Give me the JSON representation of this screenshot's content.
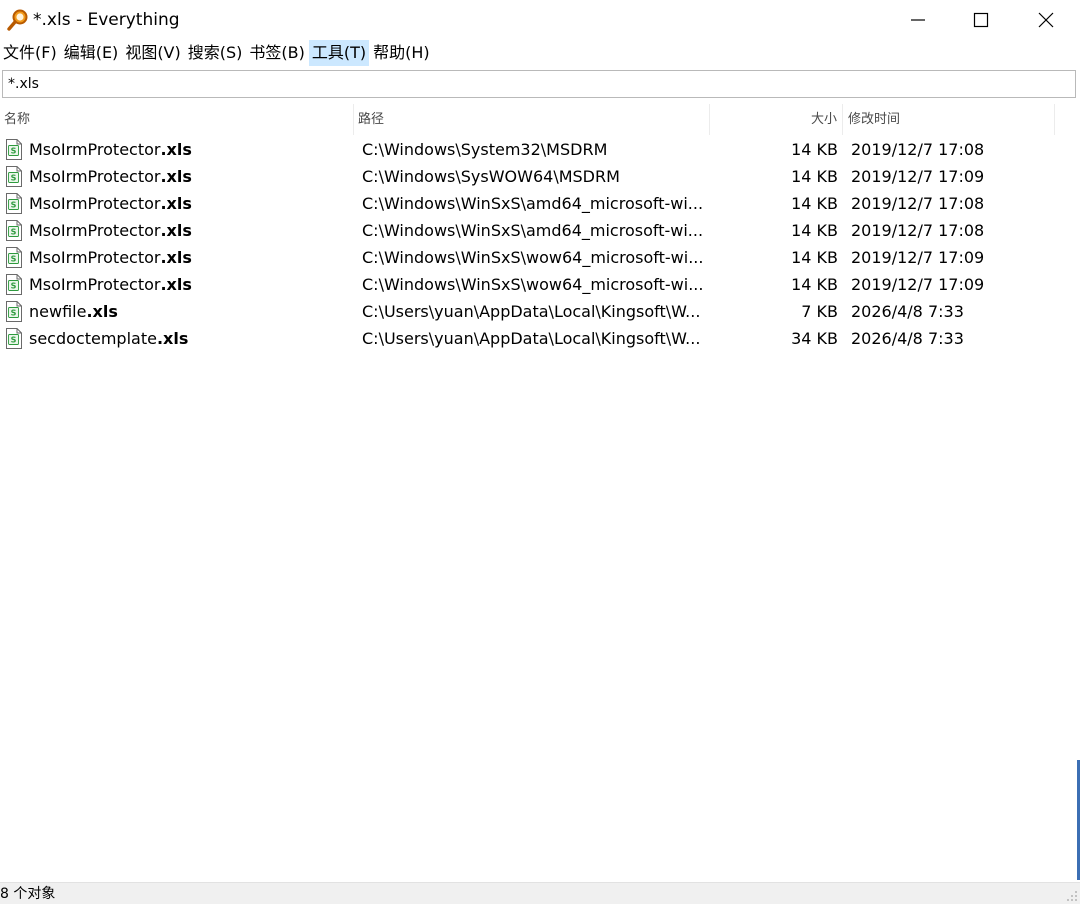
{
  "window": {
    "title": "*.xls - Everything",
    "accent_color": "#e8700f"
  },
  "menu": {
    "items": [
      {
        "label": "文件(F)",
        "active": false
      },
      {
        "label": "编辑(E)",
        "active": false
      },
      {
        "label": "视图(V)",
        "active": false
      },
      {
        "label": "搜索(S)",
        "active": false
      },
      {
        "label": "书签(B)",
        "active": false
      },
      {
        "label": "工具(T)",
        "active": true
      },
      {
        "label": "帮助(H)",
        "active": false
      }
    ]
  },
  "search": {
    "value": "*.xls",
    "placeholder": ""
  },
  "columns": {
    "name": "名称",
    "path": "路径",
    "size": "大小",
    "date": "修改时间"
  },
  "files": [
    {
      "name_stem": "MsoIrmProtector",
      "name_ext": ".xls",
      "path": "C:\\Windows\\System32\\MSDRM",
      "size": "14 KB",
      "date": "2019/12/7 17:08",
      "icon": "spreadsheet-file-icon"
    },
    {
      "name_stem": "MsoIrmProtector",
      "name_ext": ".xls",
      "path": "C:\\Windows\\SysWOW64\\MSDRM",
      "size": "14 KB",
      "date": "2019/12/7 17:09",
      "icon": "spreadsheet-file-icon"
    },
    {
      "name_stem": "MsoIrmProtector",
      "name_ext": ".xls",
      "path": "C:\\Windows\\WinSxS\\amd64_microsoft-wi...",
      "size": "14 KB",
      "date": "2019/12/7 17:08",
      "icon": "spreadsheet-file-icon"
    },
    {
      "name_stem": "MsoIrmProtector",
      "name_ext": ".xls",
      "path": "C:\\Windows\\WinSxS\\amd64_microsoft-wi...",
      "size": "14 KB",
      "date": "2019/12/7 17:08",
      "icon": "spreadsheet-file-icon"
    },
    {
      "name_stem": "MsoIrmProtector",
      "name_ext": ".xls",
      "path": "C:\\Windows\\WinSxS\\wow64_microsoft-wi...",
      "size": "14 KB",
      "date": "2019/12/7 17:09",
      "icon": "spreadsheet-file-icon"
    },
    {
      "name_stem": "MsoIrmProtector",
      "name_ext": ".xls",
      "path": "C:\\Windows\\WinSxS\\wow64_microsoft-wi...",
      "size": "14 KB",
      "date": "2019/12/7 17:09",
      "icon": "spreadsheet-file-icon"
    },
    {
      "name_stem": "newfile",
      "name_ext": ".xls",
      "path": "C:\\Users\\yuan\\AppData\\Local\\Kingsoft\\W...",
      "size": "7 KB",
      "date": "2026/4/8 7:33",
      "icon": "spreadsheet-file-icon"
    },
    {
      "name_stem": "secdoctemplate",
      "name_ext": ".xls",
      "path": "C:\\Users\\yuan\\AppData\\Local\\Kingsoft\\W...",
      "size": "34 KB",
      "date": "2026/4/8 7:33",
      "icon": "spreadsheet-file-icon"
    }
  ],
  "status": {
    "text": "8 个对象"
  }
}
